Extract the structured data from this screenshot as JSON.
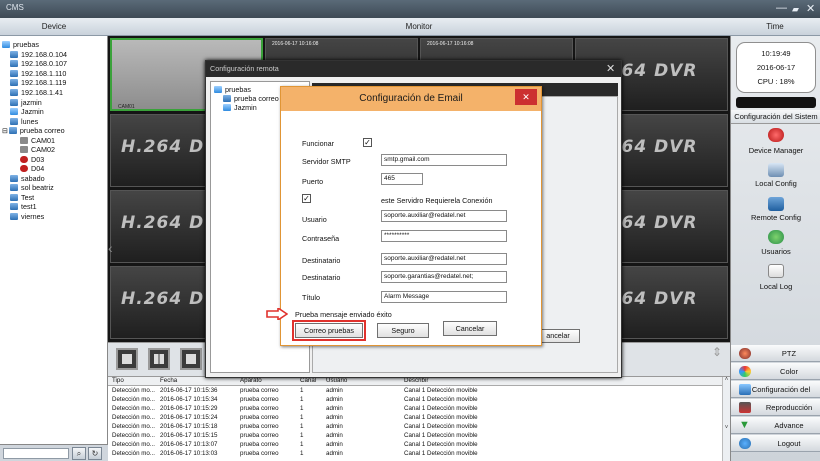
{
  "app": {
    "title": "CMS"
  },
  "headers": {
    "device": "Device",
    "monitor": "Monitor",
    "time": "Time"
  },
  "device_tree": [
    {
      "label": "pruebas",
      "icon": "group-icon"
    },
    {
      "label": "192.168.0.104",
      "icon": "device-icon"
    },
    {
      "label": "192.168.0.107",
      "icon": "device-icon"
    },
    {
      "label": "192.168.1.110",
      "icon": "device-icon"
    },
    {
      "label": "192.168.1.119",
      "icon": "device-icon"
    },
    {
      "label": "192.168.1.41",
      "icon": "device-icon"
    },
    {
      "label": "jazmin",
      "icon": "device-icon"
    },
    {
      "label": "Jazmin",
      "icon": "group-icon"
    },
    {
      "label": "lunes",
      "icon": "device-icon"
    },
    {
      "label": "prueba correo",
      "icon": "device-icon"
    },
    {
      "label": "CAM01",
      "icon": "camera-icon"
    },
    {
      "label": "CAM02",
      "icon": "camera-icon"
    },
    {
      "label": "D03",
      "icon": "alarm-icon"
    },
    {
      "label": "D04",
      "icon": "alarm-icon"
    },
    {
      "label": "sabado",
      "icon": "device-icon"
    },
    {
      "label": "sol beatriz",
      "icon": "device-icon"
    },
    {
      "label": "Test",
      "icon": "device-icon"
    },
    {
      "label": "test1",
      "icon": "device-icon"
    },
    {
      "label": "viernes",
      "icon": "device-icon"
    }
  ],
  "monitor": {
    "watermark": "H.264 DVR",
    "timestamp_1": "2016-06-17 10:16:08",
    "timestamp_2": "2016-06-17 10:16:08",
    "channel_tag": "CAM01"
  },
  "log": {
    "columns": [
      "Tipo",
      "Fecha",
      "Aparato",
      "Canal",
      "Usuario",
      "Describir"
    ],
    "rows": [
      [
        "Detección mo...",
        "2016-06-17 10:15:36",
        "prueba correo",
        "1",
        "admin",
        "Canal 1 Detección movible"
      ],
      [
        "Detección mo...",
        "2016-06-17 10:15:34",
        "prueba correo",
        "1",
        "admin",
        "Canal 1 Detección movible"
      ],
      [
        "Detección mo...",
        "2016-06-17 10:15:29",
        "prueba correo",
        "1",
        "admin",
        "Canal 1 Detección movible"
      ],
      [
        "Detección mo...",
        "2016-06-17 10:15:24",
        "prueba correo",
        "1",
        "admin",
        "Canal 1 Detección movible"
      ],
      [
        "Detección mo...",
        "2016-06-17 10:15:18",
        "prueba correo",
        "1",
        "admin",
        "Canal 1 Detección movible"
      ],
      [
        "Detección mo...",
        "2016-06-17 10:15:15",
        "prueba correo",
        "1",
        "admin",
        "Canal 1 Detección movible"
      ],
      [
        "Detección mo...",
        "2016-06-17 10:13:07",
        "prueba correo",
        "1",
        "admin",
        "Canal 1 Detección movible"
      ],
      [
        "Detección mo...",
        "2016-06-17 10:13:03",
        "prueba correo",
        "1",
        "admin",
        "Canal 1 Detección movible"
      ]
    ]
  },
  "clock": {
    "time": "10:19:49",
    "date": "2016-06-17",
    "cpu": "CPU : 18%"
  },
  "right_panel": {
    "system_config": "Configuración del Sistem",
    "device_manager": "Device Manager",
    "local_config": "Local Config",
    "remote_config": "Remote Config",
    "users": "Usuarios",
    "local_log": "Local Log",
    "system_config_2": "Configuración del Sistem",
    "ptz": "PTZ",
    "color": "Color",
    "playback": "Reproducción",
    "advance": "Advance",
    "logout": "Logout"
  },
  "remote_config": {
    "title": "Configuración remota",
    "tree": [
      "pruebas",
      "prueba correo",
      "Jazmin"
    ],
    "cancel_label": "ancelar"
  },
  "email_dialog": {
    "title": "Configuración de Email",
    "enable_label": "Funcionar",
    "smtp_label": "Servidor SMTP",
    "smtp_value": "smtp.gmail.com",
    "port_label": "Puerto",
    "port_value": "465",
    "ssl_label": "este Servidro Requierela Conexión",
    "user_label": "Usuario",
    "user_value": "soporte.auxiliar@redatel.net",
    "password_label": "Contraseña",
    "password_value": "**********",
    "sender_label": "Destinatario",
    "sender_value": "soporte.auxiliar@redatel.net",
    "recipient_label": "Destinatario",
    "recipient_value": "soporte.garantias@redatel.net;",
    "subject_label": "Título",
    "subject_value": "Alarm Message",
    "status_text": "Prueba mensaje enviado éxito",
    "test_button": "Correo pruebas",
    "ok_button": "Seguro",
    "cancel_button": "Cancelar"
  },
  "colors": {
    "highlight": "#e0322d",
    "dialog_title": "#f4b26a",
    "close": "#cc3030"
  }
}
